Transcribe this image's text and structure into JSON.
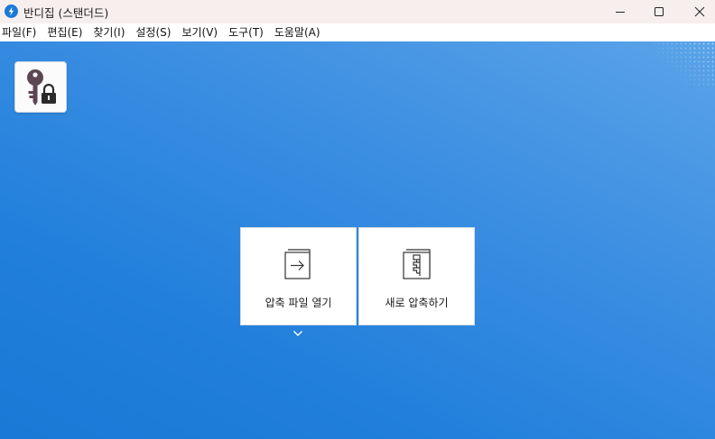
{
  "window": {
    "title": "반디집 (스탠더드)"
  },
  "menu": [
    {
      "label": "파일(F)"
    },
    {
      "label": "편집(E)"
    },
    {
      "label": "찾기(I)"
    },
    {
      "label": "설정(S)"
    },
    {
      "label": "보기(V)"
    },
    {
      "label": "도구(T)"
    },
    {
      "label": "도움말(A)"
    }
  ],
  "tiles": {
    "open": {
      "label": "압축 파일 열기",
      "icon": "open-archive-icon"
    },
    "new": {
      "label": "새로 압축하기",
      "icon": "zip-archive-icon"
    }
  },
  "icons": {
    "app": "bandizip-icon",
    "password": "key-lock-icon",
    "expand": "chevron-down-icon"
  },
  "colors": {
    "accent": "#2280dc",
    "titlebar": "#f7efee"
  }
}
